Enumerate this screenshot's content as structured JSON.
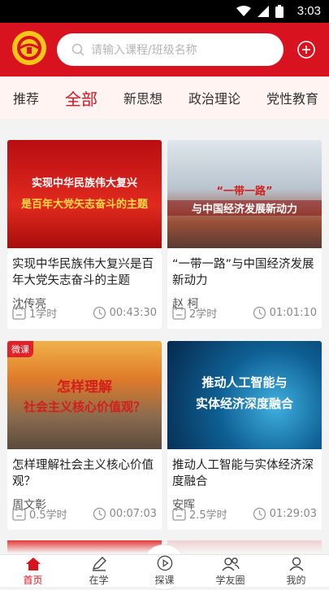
{
  "status_bar": {
    "time": "3:03"
  },
  "search": {
    "placeholder": "请输入课程/班级名称"
  },
  "tabs": [
    {
      "label": "推荐",
      "active": false
    },
    {
      "label": "全部",
      "active": true
    },
    {
      "label": "新思想",
      "active": false
    },
    {
      "label": "政治理论",
      "active": false
    },
    {
      "label": "党性教育",
      "active": false
    }
  ],
  "courses": [
    {
      "thumb_text": [
        "实现中华民族伟大复兴",
        "是百年大党矢志奋斗的主题"
      ],
      "title": "实现中华民族伟大复兴是百年大党矢志奋斗的主题",
      "author": "沈传亮",
      "hours": "1学时",
      "duration": "00:43:30",
      "badge": ""
    },
    {
      "thumb_text": [
        "“一带一路”",
        "与中国经济发展新动力"
      ],
      "title": "“一带一路”与中国经济发展新动力",
      "author": "赵 柯",
      "hours": "2学时",
      "duration": "01:01:10",
      "badge": ""
    },
    {
      "thumb_text": [
        "怎样理解",
        "社会主义核心价值观？"
      ],
      "title": "怎样理解社会主义核心价值观？",
      "author": "周文彰",
      "hours": "0.5学时",
      "duration": "00:07:03",
      "badge": "微课"
    },
    {
      "thumb_text": [
        "推动人工智能与",
        "实体经济深度融合"
      ],
      "title": "推动人工智能与实体经济深度融合",
      "author": "安晖",
      "hours": "2.5学时",
      "duration": "01:29:03",
      "badge": ""
    }
  ],
  "nav": [
    {
      "label": "首页",
      "icon": "home-icon",
      "active": true
    },
    {
      "label": "在学",
      "icon": "pen-icon",
      "active": false
    },
    {
      "label": "探课",
      "icon": "play-icon",
      "active": false
    },
    {
      "label": "学友圈",
      "icon": "friends-icon",
      "active": false
    },
    {
      "label": "我的",
      "icon": "user-icon",
      "active": false
    }
  ],
  "colors": {
    "brand_red": "#d8131f",
    "logo_yellow": "#f5c518"
  }
}
